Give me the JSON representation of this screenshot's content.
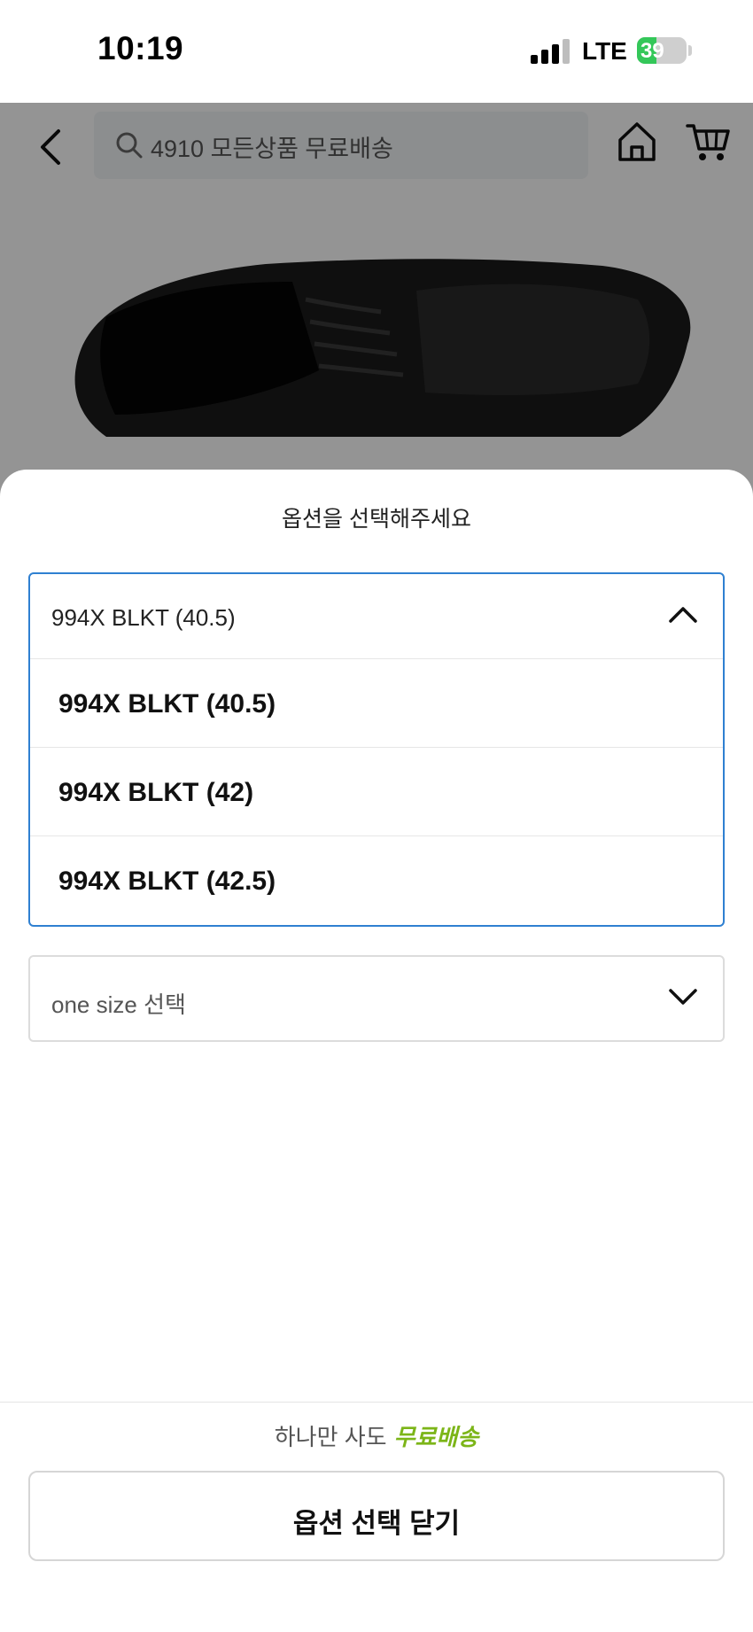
{
  "status_bar": {
    "time": "10:19",
    "network": "LTE",
    "battery": "39",
    "battery_level": 0.39,
    "colors": {
      "battery_fill": "#34c759"
    }
  },
  "header": {
    "search_text": "4910 모든상품 무료배송",
    "icons": {
      "back": "chevron-left-icon",
      "search": "search-icon",
      "home": "home-icon",
      "cart": "cart-icon"
    }
  },
  "sheet": {
    "title": "옵션을 선택해주세요",
    "dropdown": {
      "selected": "994X BLKT (40.5)",
      "options": [
        {
          "label": "994X BLKT (40.5)"
        },
        {
          "label": "994X BLKT (42)"
        },
        {
          "label": "994X BLKT (42.5)"
        }
      ],
      "accent": "#2f80d1",
      "icon": "chevron-up-icon"
    },
    "size_select": {
      "placeholder": "one size 선택",
      "icon": "chevron-down-icon"
    },
    "promo": {
      "text": "하나만 사도",
      "highlight": "무료배송",
      "highlight_color": "#7cb518"
    },
    "close_label": "옵션 선택 닫기"
  }
}
